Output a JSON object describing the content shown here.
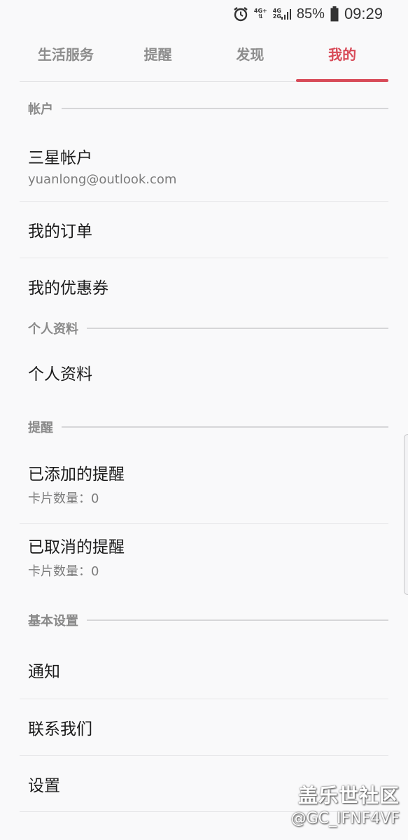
{
  "status_bar": {
    "alarm_icon": "alarm-clock-icon",
    "net1_top": "4G+",
    "net1_bottom": "⇅",
    "net2_top": "4G",
    "net2_bottom": "2G",
    "battery_percent": "85%",
    "time": "09:29"
  },
  "tabs": [
    {
      "label": "生活服务",
      "active": false
    },
    {
      "label": "提醒",
      "active": false
    },
    {
      "label": "发现",
      "active": false
    },
    {
      "label": "我的",
      "active": true
    }
  ],
  "sections": {
    "account": {
      "header": "帐户",
      "samsung_account": {
        "title": "三星帐户",
        "subtitle": "yuanlong@outlook.com"
      },
      "my_orders": {
        "title": "我的订单"
      },
      "my_coupons": {
        "title": "我的优惠券"
      }
    },
    "profile": {
      "header": "个人资料",
      "profile_item": {
        "title": "个人资料"
      }
    },
    "reminders": {
      "header": "提醒",
      "added": {
        "title": "已添加的提醒",
        "subtitle": "卡片数量：0"
      },
      "cancelled": {
        "title": "已取消的提醒",
        "subtitle": "卡片数量：0"
      }
    },
    "basic_settings": {
      "header": "基本设置",
      "notifications": {
        "title": "通知"
      },
      "contact_us": {
        "title": "联系我们"
      },
      "settings": {
        "title": "设置"
      }
    }
  },
  "watermark": {
    "title": "盖乐世社区",
    "handle": "@GC_IFNF4VF"
  },
  "colors": {
    "accent": "#d84a58",
    "background": "#f9f9fa"
  }
}
